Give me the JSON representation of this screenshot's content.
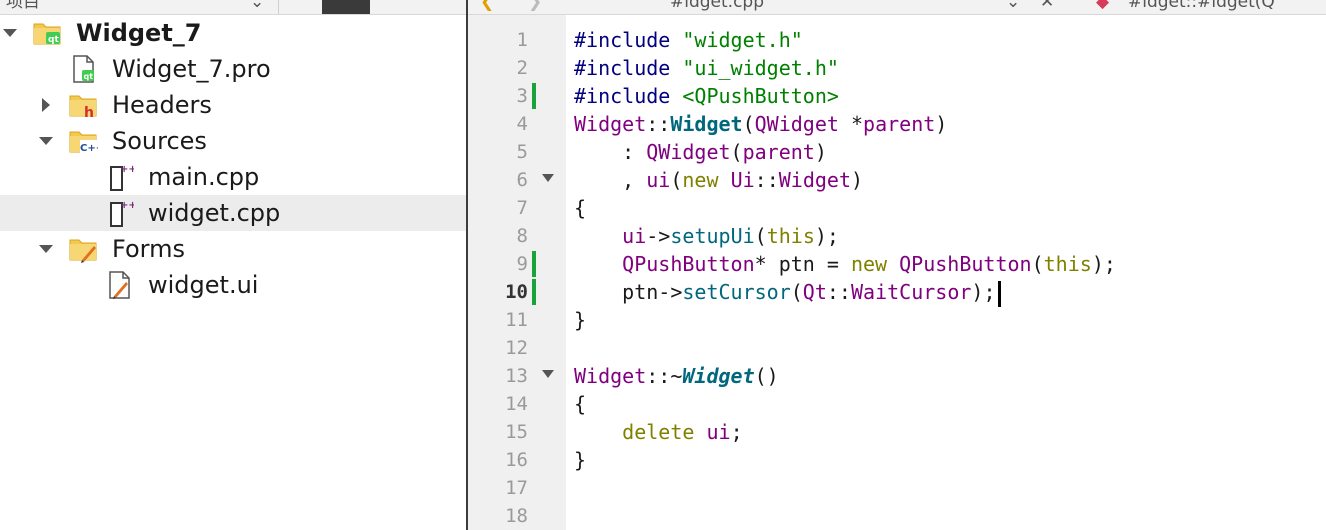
{
  "toolbar": {
    "left_text": "项目",
    "chevron": "⌄",
    "file_tab": "#idget.cpp",
    "symbol_text": "#idget::#idget(Q"
  },
  "project_tree": [
    {
      "label": "Widget_7",
      "icon": "qt-project-folder-icon",
      "expand": "down",
      "indent": 0,
      "bold": true,
      "selected": false
    },
    {
      "label": "Widget_7.pro",
      "icon": "pro-file-icon",
      "expand": "none",
      "indent": 1,
      "bold": false,
      "selected": false
    },
    {
      "label": "Headers",
      "icon": "headers-folder-icon",
      "expand": "right",
      "indent": 1,
      "bold": false,
      "selected": false
    },
    {
      "label": "Sources",
      "icon": "sources-folder-icon",
      "expand": "down",
      "indent": 1,
      "bold": false,
      "selected": false
    },
    {
      "label": "main.cpp",
      "icon": "cpp-file-icon",
      "expand": "none",
      "indent": 2,
      "bold": false,
      "selected": false
    },
    {
      "label": "widget.cpp",
      "icon": "cpp-file-icon",
      "expand": "none",
      "indent": 2,
      "bold": false,
      "selected": true
    },
    {
      "label": "Forms",
      "icon": "forms-folder-icon",
      "expand": "down",
      "indent": 1,
      "bold": false,
      "selected": false
    },
    {
      "label": "widget.ui",
      "icon": "ui-file-icon",
      "expand": "none",
      "indent": 2,
      "bold": false,
      "selected": false
    }
  ],
  "editor": {
    "current_line": 10,
    "changed_lines": [
      3,
      9,
      10
    ],
    "fold_lines": [
      6,
      13
    ],
    "lines": [
      [
        [
          "pp",
          "#include "
        ],
        [
          "str",
          "\"widget.h\""
        ]
      ],
      [
        [
          "pp",
          "#include "
        ],
        [
          "str",
          "\"ui_widget.h\""
        ]
      ],
      [
        [
          "pp",
          "#include "
        ],
        [
          "str",
          "<QPushButton>"
        ]
      ],
      [
        [
          "ty",
          "Widget"
        ],
        [
          "op",
          "::"
        ],
        [
          "fnb",
          "Widget"
        ],
        [
          "op",
          "("
        ],
        [
          "ty",
          "QWidget"
        ],
        [
          "op",
          " *"
        ],
        [
          "ty",
          "parent"
        ],
        [
          "op",
          ")"
        ]
      ],
      [
        [
          "op",
          "    : "
        ],
        [
          "ty",
          "QWidget"
        ],
        [
          "op",
          "("
        ],
        [
          "ty",
          "parent"
        ],
        [
          "op",
          ")"
        ]
      ],
      [
        [
          "op",
          "    , "
        ],
        [
          "ty",
          "ui"
        ],
        [
          "op",
          "("
        ],
        [
          "kw",
          "new "
        ],
        [
          "ty",
          "Ui"
        ],
        [
          "op",
          "::"
        ],
        [
          "ty",
          "Widget"
        ],
        [
          "op",
          ")"
        ]
      ],
      [
        [
          "op",
          "{"
        ]
      ],
      [
        [
          "op",
          "    "
        ],
        [
          "ty",
          "ui"
        ],
        [
          "op",
          "->"
        ],
        [
          "fn",
          "setupUi"
        ],
        [
          "op",
          "("
        ],
        [
          "kw",
          "this"
        ],
        [
          "op",
          ");"
        ]
      ],
      [
        [
          "op",
          "    "
        ],
        [
          "ty",
          "QPushButton"
        ],
        [
          "op",
          "* "
        ],
        [
          "op",
          "ptn = "
        ],
        [
          "kw",
          "new "
        ],
        [
          "ty",
          "QPushButton"
        ],
        [
          "op",
          "("
        ],
        [
          "kw",
          "this"
        ],
        [
          "op",
          ");"
        ]
      ],
      [
        [
          "op",
          "    ptn->"
        ],
        [
          "fn",
          "setCursor"
        ],
        [
          "op",
          "("
        ],
        [
          "ty",
          "Qt"
        ],
        [
          "op",
          "::"
        ],
        [
          "ty",
          "WaitCursor"
        ],
        [
          "op",
          ");"
        ]
      ],
      [
        [
          "op",
          "}"
        ]
      ],
      [],
      [
        [
          "ty",
          "Widget"
        ],
        [
          "op",
          "::~"
        ],
        [
          "fni",
          "Widget"
        ],
        [
          "op",
          "()"
        ]
      ],
      [
        [
          "op",
          "{"
        ]
      ],
      [
        [
          "op",
          "    "
        ],
        [
          "kw",
          "delete "
        ],
        [
          "ty",
          "ui"
        ],
        [
          "op",
          ";"
        ]
      ],
      [
        [
          "op",
          "}"
        ]
      ],
      [],
      []
    ]
  }
}
